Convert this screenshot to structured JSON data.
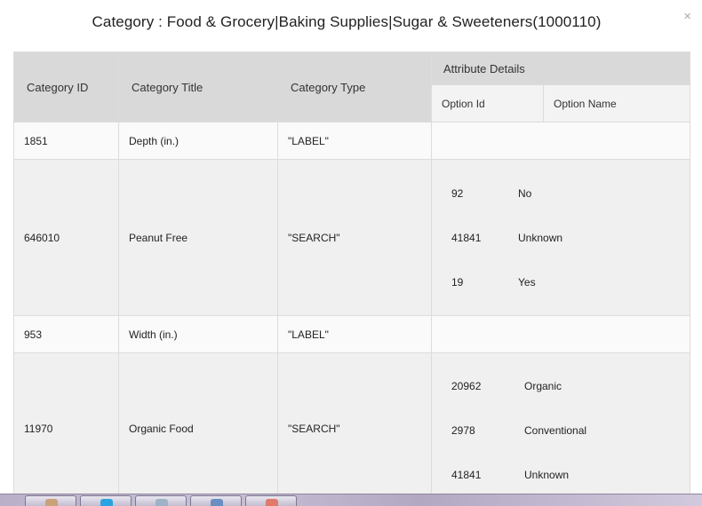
{
  "modal": {
    "title": "Category : Food & Grocery|Baking Supplies|Sugar & Sweeteners(1000110)",
    "close_symbol": "×"
  },
  "table": {
    "headers": {
      "category_id": "Category ID",
      "category_title": "Category Title",
      "category_type": "Category Type",
      "attribute_details": "Attribute Details",
      "option_id": "Option Id",
      "option_name": "Option Name"
    },
    "rows": [
      {
        "id": "1851",
        "title": "Depth (in.)",
        "type": "\"LABEL\"",
        "options": []
      },
      {
        "id": "646010",
        "title": "Peanut Free",
        "type": "\"SEARCH\"",
        "options": [
          {
            "id": "92",
            "name": "No"
          },
          {
            "id": "41841",
            "name": "Unknown"
          },
          {
            "id": "19",
            "name": "Yes"
          }
        ]
      },
      {
        "id": "953",
        "title": "Width (in.)",
        "type": "\"LABEL\"",
        "options": []
      },
      {
        "id": "11970",
        "title": "Organic Food",
        "type": "\"SEARCH\"",
        "options": [
          {
            "id": "20962",
            "name": "Organic"
          },
          {
            "id": "2978",
            "name": "Conventional"
          },
          {
            "id": "41841",
            "name": "Unknown"
          }
        ]
      }
    ]
  },
  "taskbar": {
    "buttons": [
      {
        "icon": "folder-icon",
        "color": "#c9a27a"
      },
      {
        "icon": "skype-icon",
        "color": "#2aa3e0"
      },
      {
        "icon": "notepad-icon",
        "color": "#9fb3c8"
      },
      {
        "icon": "media-icon",
        "color": "#6a8fc0"
      },
      {
        "icon": "pdf-icon",
        "color": "#e07a6a"
      }
    ]
  }
}
